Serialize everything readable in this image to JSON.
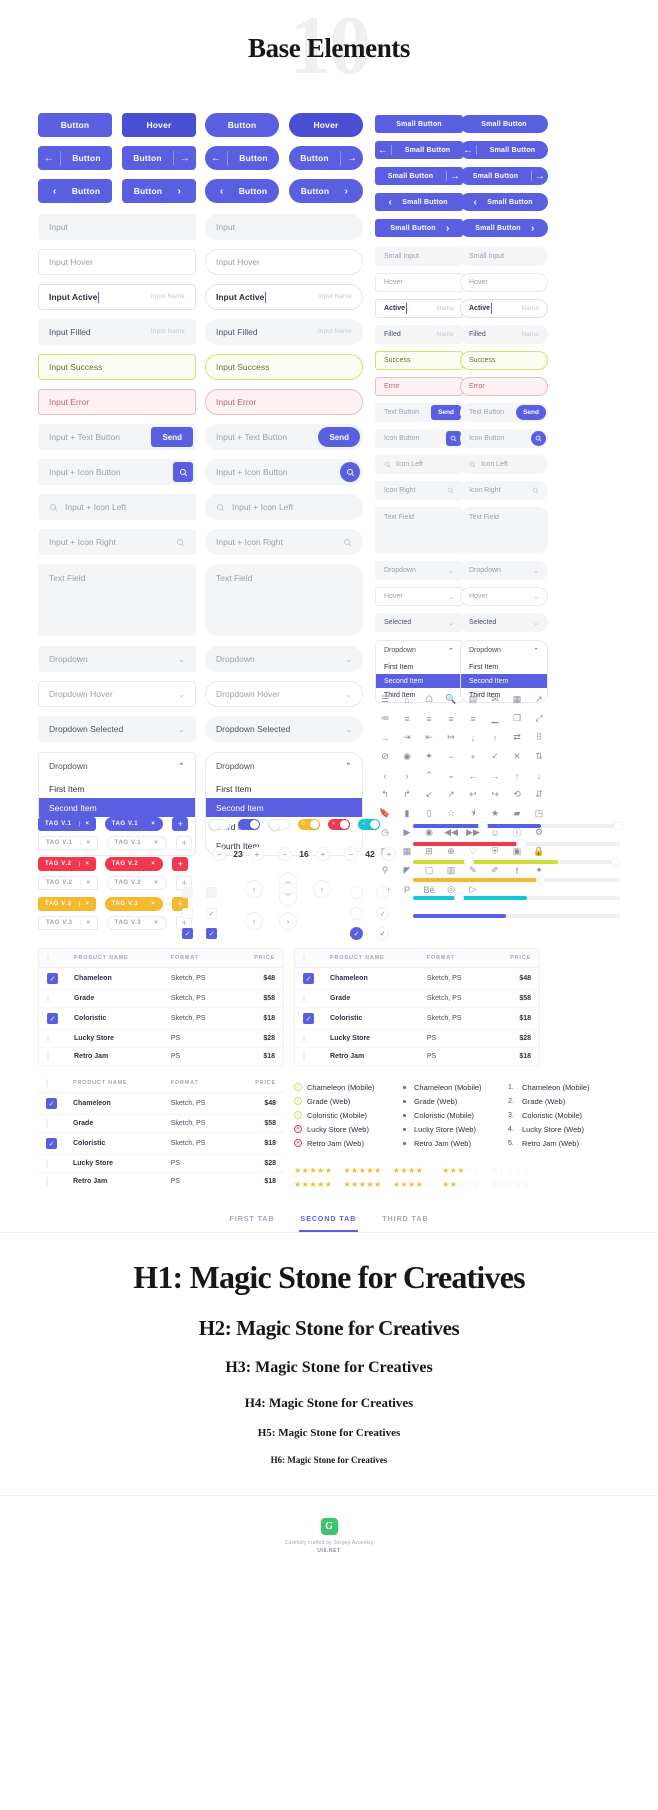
{
  "hero": {
    "number": "10",
    "title": "Base Elements"
  },
  "buttons": {
    "square": [
      {
        "label": "Button",
        "state": "default"
      },
      {
        "label": "Hover",
        "state": "hover"
      }
    ],
    "pill": [
      {
        "label": "Button",
        "state": "default"
      },
      {
        "label": "Hover",
        "state": "hover"
      }
    ],
    "with_arrow": [
      {
        "label": "Button",
        "icon": "arrow-left",
        "side": "left"
      },
      {
        "label": "Button",
        "icon": "arrow-right",
        "side": "right"
      }
    ],
    "with_chevron": [
      {
        "label": "Button",
        "icon": "chevron-left",
        "side": "left"
      },
      {
        "label": "Button",
        "icon": "chevron-right",
        "side": "right"
      }
    ],
    "small": [
      {
        "label": "Small Button",
        "icon": "none"
      },
      {
        "label": "Small Button",
        "icon": "arrow-left",
        "side": "left"
      },
      {
        "label": "Small Button",
        "icon": "arrow-right",
        "side": "right"
      },
      {
        "label": "Small Button",
        "icon": "chevron-left",
        "side": "left"
      },
      {
        "label": "Small Button",
        "icon": "chevron-right",
        "side": "right"
      }
    ]
  },
  "inputs": {
    "large": [
      {
        "value": "Input",
        "state": "default"
      },
      {
        "value": "Input Hover",
        "state": "hover"
      },
      {
        "value": "Input Active",
        "state": "active",
        "hint": "Input Name"
      },
      {
        "value": "Input Filled",
        "state": "filled",
        "hint": "Input Name"
      },
      {
        "value": "Input Success",
        "state": "success"
      },
      {
        "value": "Input Error",
        "state": "error"
      }
    ],
    "small": [
      {
        "value": "Small Input",
        "state": "default"
      },
      {
        "value": "Hover",
        "state": "hover"
      },
      {
        "value": "Active",
        "state": "active",
        "hint": "Name"
      },
      {
        "value": "Filled",
        "state": "filled",
        "hint": "Name"
      },
      {
        "value": "Success",
        "state": "success"
      },
      {
        "value": "Error",
        "state": "error"
      }
    ],
    "with_text_button": {
      "placeholder": "Input + Text Button",
      "button": "Send"
    },
    "with_icon_button": {
      "placeholder": "Input + Icon Button",
      "icon": "search-icon"
    },
    "icon_left": {
      "placeholder": "Input + Icon Left",
      "icon": "search-icon"
    },
    "icon_right": {
      "placeholder": "Input + Icon Right",
      "icon": "search-icon"
    },
    "text_field": {
      "placeholder": "Text Field"
    },
    "small_with_text_button": {
      "placeholder": "Text Button",
      "button": "Send"
    },
    "small_with_icon_button": {
      "placeholder": "Icon Button",
      "icon": "search-icon"
    },
    "small_icon_left": {
      "placeholder": "Icon Left"
    },
    "small_icon_right": {
      "placeholder": "Icon Right"
    },
    "small_text_field": {
      "placeholder": "Text Field"
    }
  },
  "dropdowns": {
    "states": [
      {
        "label": "Dropdown",
        "state": "default"
      },
      {
        "label": "Dropdown Hover",
        "state": "hover"
      },
      {
        "label": "Dropdown Selected",
        "state": "selected"
      }
    ],
    "small_states": [
      {
        "label": "Dropdown",
        "state": "default"
      },
      {
        "label": "Hover",
        "state": "hover"
      },
      {
        "label": "Selected",
        "state": "selected"
      }
    ],
    "open": {
      "header": "Dropdown",
      "items": [
        "First Item",
        "Second Item",
        "Third Item",
        "Fourth Item"
      ],
      "selected_index": 1
    },
    "open_small": {
      "header": "Dropdown",
      "items": [
        "First Item",
        "Second Item",
        "Third Item"
      ],
      "selected_index": 1
    }
  },
  "icon_grid": {
    "rows": [
      [
        "menu-icon",
        "home-icon",
        "user-icon",
        "search-icon",
        "inbox-icon",
        "mail-icon",
        "chart-bar-icon",
        "external-link-icon"
      ],
      [
        "list-ordered-icon",
        "align-justify-icon",
        "align-center-icon",
        "align-right-icon",
        "align-left-icon",
        "signal-icon",
        "copy-icon",
        "maximize-icon"
      ],
      [
        "log-in-icon",
        "arrow-in-icon",
        "arrow-out-icon",
        "log-out-icon",
        "download-icon",
        "upload-icon",
        "refresh-icon",
        "grid-icon"
      ],
      [
        "ban-icon",
        "eye-off-icon",
        "sparkle-icon",
        "minus-icon",
        "plus-icon",
        "check-icon",
        "close-icon",
        "shuffle-icon"
      ],
      [
        "chevron-left-icon",
        "chevron-right-icon",
        "chevron-up-icon",
        "chevron-down-icon",
        "arrow-left-icon",
        "arrow-right-icon",
        "arrow-up-icon",
        "arrow-down-icon"
      ],
      [
        "corner-up-left-icon",
        "corner-up-right-icon",
        "arrow-down-left-icon",
        "arrow-up-right-icon",
        "reply-icon",
        "forward-icon",
        "repeat-icon",
        "sort-icon"
      ],
      [
        "bookmark-icon",
        "bookmark-filled-icon",
        "bookmark-add-icon",
        "star-icon",
        "star-half-icon",
        "star-filled-icon",
        "folder-icon",
        "layers-icon"
      ],
      [
        "clock-icon",
        "play-icon",
        "record-icon",
        "rewind-icon",
        "fast-forward-icon",
        "smile-icon",
        "info-icon",
        "settings-icon"
      ],
      [
        "calendar-icon",
        "dashboard-icon",
        "apps-icon",
        "zoom-in-icon",
        "heart-icon",
        "shield-icon",
        "camera-icon",
        "lock-icon"
      ],
      [
        "map-pin-icon",
        "tag-icon",
        "trash-icon",
        "image-icon",
        "pen-icon",
        "edit-icon",
        "facebook-icon",
        "twitter-icon"
      ],
      [
        "google-plus-icon",
        "pinterest-icon",
        "behance-icon",
        "dribbble-icon",
        "youtube-icon",
        "",
        "",
        ""
      ]
    ]
  },
  "tags": {
    "variants": [
      {
        "name": "TAG V.1",
        "color": "v1"
      },
      {
        "name": "TAG V.2",
        "color": "v2"
      },
      {
        "name": "TAG V.3",
        "color": "v3"
      }
    ],
    "close_label": "×",
    "plus_label": "+"
  },
  "toggles": [
    {
      "state": "off",
      "color": "grey",
      "mark": ""
    },
    {
      "state": "on",
      "color": "blue",
      "mark": ""
    },
    {
      "state": "off",
      "color": "grey",
      "mark": "−"
    },
    {
      "state": "on",
      "color": "yellow",
      "mark": "0"
    },
    {
      "state": "on",
      "color": "red",
      "mark": "×"
    },
    {
      "state": "on",
      "color": "cyan",
      "mark": "✓"
    }
  ],
  "steppers": [
    {
      "value": "23"
    },
    {
      "value": "16"
    },
    {
      "value": "42"
    }
  ],
  "pager": {
    "prev": "‹",
    "next": "›",
    "up": "︿",
    "down": "﹀"
  },
  "sliders": [
    {
      "color": "#5a5ee0",
      "fill_pct": 62,
      "knobs": [
        34,
        99
      ],
      "track": "right"
    },
    {
      "color": "#f0394f",
      "fill_pct": 52,
      "knobs": [
        52
      ],
      "track": "left"
    },
    {
      "color": "#cddc39",
      "fill_pct": 70,
      "knobs": [
        27,
        98
      ],
      "track": "mid"
    },
    {
      "color": "#f5b92e",
      "fill_pct": 62,
      "knobs": [
        62
      ],
      "track": "left"
    },
    {
      "color": "#19c4d6",
      "fill_pct": 55,
      "knobs": [
        22
      ],
      "track": "mid"
    },
    {
      "color": "#5a5ee0",
      "fill_pct": 45,
      "knobs": [],
      "track": "left"
    }
  ],
  "table": {
    "columns": [
      "PRODUCT NAME",
      "FORMAT",
      "PRICE"
    ],
    "rows": [
      {
        "checked": true,
        "name": "Chameleon",
        "format": "Sketch, PS",
        "price": "$48"
      },
      {
        "checked": false,
        "name": "Grade",
        "format": "Sketch, PS",
        "price": "$58"
      },
      {
        "checked": true,
        "name": "Coloristic",
        "format": "Sketch, PS",
        "price": "$18"
      },
      {
        "checked": false,
        "name": "Lucky Store",
        "format": "PS",
        "price": "$28"
      },
      {
        "checked": false,
        "name": "Retro Jam",
        "format": "PS",
        "price": "$18"
      }
    ]
  },
  "lists": {
    "check": [
      {
        "label": "Chameleon (Mobile)",
        "status": "ok"
      },
      {
        "label": "Grade (Web)",
        "status": "ok"
      },
      {
        "label": "Coloristic (Mobile)",
        "status": "ok"
      },
      {
        "label": "Lucky Store (Web)",
        "status": "no"
      },
      {
        "label": "Retro Jam (Web)",
        "status": "no"
      }
    ],
    "bullet": [
      "Chameleon (Mobile)",
      "Grade (Web)",
      "Coloristic (Mobile)",
      "Lucky Store (Web)",
      "Retro Jam (Web)"
    ],
    "numbered": [
      "Chameleon (Mobile)",
      "Grade (Web)",
      "Coloristic (Mobile)",
      "Lucky Store (Web)",
      "Retro Jam (Web)"
    ]
  },
  "ratings": [
    {
      "filled": 5
    },
    {
      "filled": 4.5
    },
    {
      "filled": 4
    },
    {
      "filled": 3
    },
    {
      "filled": 0
    },
    {
      "filled": 5
    },
    {
      "filled": 4.5
    },
    {
      "filled": 3.5
    },
    {
      "filled": 1.5
    },
    {
      "filled": 0
    }
  ],
  "tabs": [
    {
      "label": "FIRST TAB",
      "active": false
    },
    {
      "label": "SECOND TAB",
      "active": true
    },
    {
      "label": "THIRD TAB",
      "active": false
    }
  ],
  "headings": [
    {
      "level": "H1",
      "text": "H1: Magic Stone for Creatives"
    },
    {
      "level": "H2",
      "text": "H2: Magic Stone for Creatives"
    },
    {
      "level": "H3",
      "text": "H3: Magic Stone for Creatives"
    },
    {
      "level": "H4",
      "text": "H4: Magic Stone for Creatives"
    },
    {
      "level": "H5",
      "text": "H5: Magic Stone for Creatives"
    },
    {
      "level": "H6",
      "text": "H6: Magic Stone for Creatives"
    }
  ],
  "footer": {
    "logo_glyph": "G",
    "caption": "Carefully crafted by Sergey Azovskiy",
    "site": "UI8.NET"
  },
  "colors": {
    "primary": "#5a5ee0",
    "primary_hover": "#4a4ed2",
    "success": "#d7e06a",
    "error": "#f0394f",
    "warning": "#f5b92e",
    "cyan": "#19c4d6"
  }
}
